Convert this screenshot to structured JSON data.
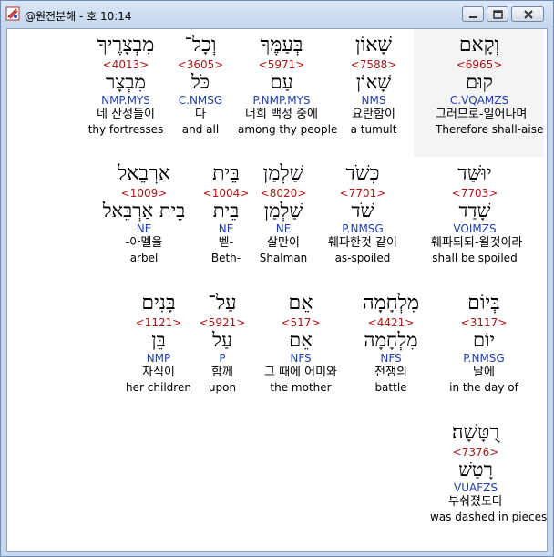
{
  "window": {
    "title": "@원전분해 - 호 10:14"
  },
  "words": [
    {
      "heb": "וְקָאם",
      "num": "<6965>",
      "lemma": "קוּם",
      "morph": "C.VQAMZS",
      "kor": "그러므로-일어나며",
      "eng": "Therefore shall-aise"
    },
    {
      "heb": "שָׁאוֹן",
      "num": "<7588>",
      "lemma": "שָׁאוֹן",
      "morph": "NMS",
      "kor": "요란함이",
      "eng": "a tumult"
    },
    {
      "heb": "בְּעַמֶּךָ",
      "num": "<5971>",
      "lemma": "עַם",
      "morph": "P.NMP.MYS",
      "kor": "너희 백성 중에",
      "eng": "among thy people"
    },
    {
      "heb": "וְכָל־",
      "num": "<3605>",
      "lemma": "כֹּל",
      "morph": "C.NMSG",
      "kor": "다",
      "eng": "and all"
    },
    {
      "heb": "מִבְצָרֶיךָ",
      "num": "<4013>",
      "lemma": "מִבְצָר",
      "morph": "NMP.MYS",
      "kor": "네 산성들이",
      "eng": "thy fortresses"
    },
    {
      "heb": "יוּשַּׁד",
      "num": "<7703>",
      "lemma": "שָׁדַד",
      "morph": "VOIMZS",
      "kor": "훼파되되-욀것이라",
      "eng": "shall be spoiled"
    },
    {
      "heb": "כְּשֹׁד",
      "num": "<7701>",
      "lemma": "שֹׁד",
      "morph": "P.NMSG",
      "kor": "훼파한것 같이",
      "eng": "as-spoiled"
    },
    {
      "heb": "שַׁלְמַן",
      "num": "<8020>",
      "lemma": "שַׁלְמַן",
      "morph": "NE",
      "kor": "살만이",
      "eng": "Shalman"
    },
    {
      "heb": "בֵּית",
      "num": "<1004>",
      "lemma": "בֵּית",
      "morph": "NE",
      "kor": "벧-",
      "eng": "Beth-"
    },
    {
      "heb": "אַרְבֵאל",
      "num": "<1009>",
      "lemma": "בֵּית אַרְבֵּאל",
      "morph": "NE",
      "kor": "-아멜을",
      "eng": "arbel"
    },
    {
      "heb": "בְּיוֹם",
      "num": "<3117>",
      "lemma": "יוֹם",
      "morph": "P.NMSG",
      "kor": "날에",
      "eng": "in the day of"
    },
    {
      "heb": "מִלְחָמָה",
      "num": "<4421>",
      "lemma": "מִלְחָמָה",
      "morph": "NFS",
      "kor": "전쟁의",
      "eng": "battle"
    },
    {
      "heb": "אֵם",
      "num": "<517>",
      "lemma": "אֵם",
      "morph": "NFS",
      "kor": "그 때에 어미와",
      "eng": "the mother"
    },
    {
      "heb": "עַל־",
      "num": "<5921>",
      "lemma": "עַל",
      "morph": "P",
      "kor": "함께",
      "eng": "upon"
    },
    {
      "heb": "בָּנִים",
      "num": "<1121>",
      "lemma": "בֵּן",
      "morph": "NMP",
      "kor": "자식이",
      "eng": "her children"
    },
    {
      "heb": "רֻטָּשָׁה׃",
      "num": "<7376>",
      "lemma": "רָטַשׁ",
      "morph": "VUAFZS",
      "kor": "부숴졌도다",
      "eng": "was dashed in pieces"
    }
  ]
}
